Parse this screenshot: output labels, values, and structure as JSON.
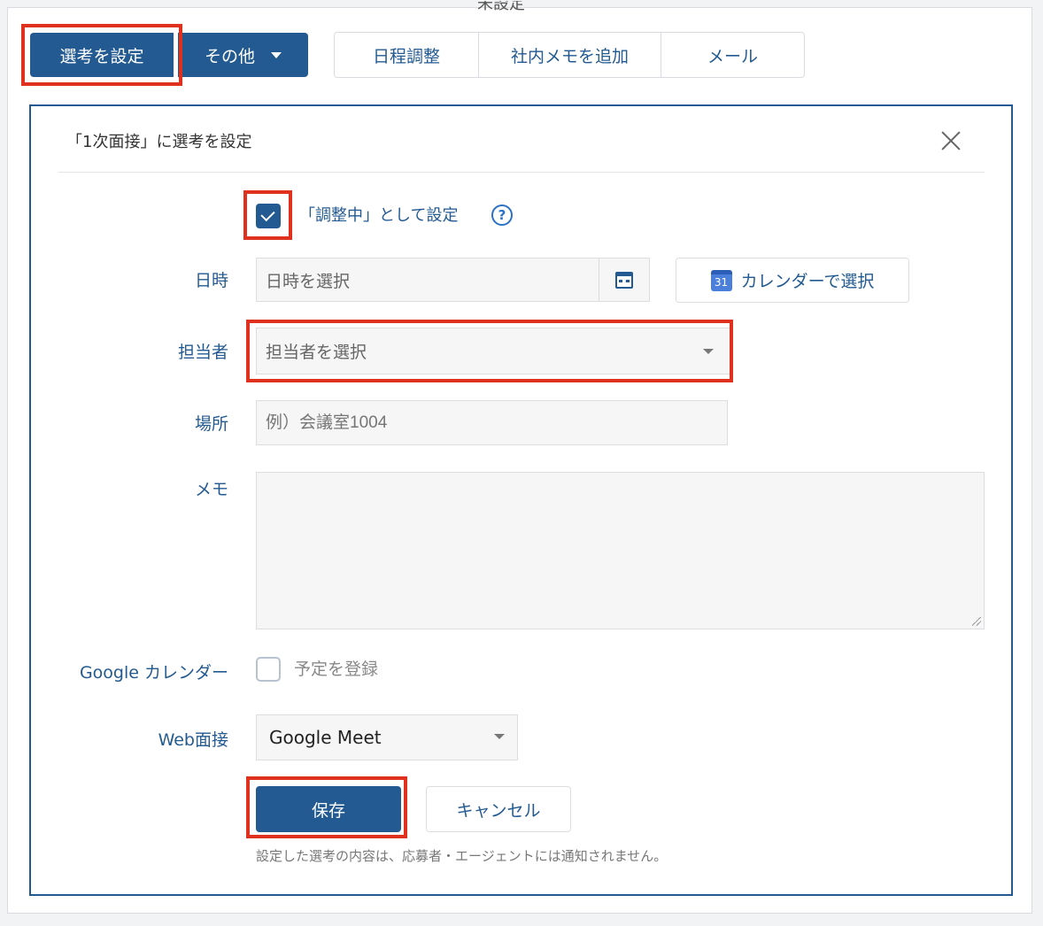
{
  "header": {
    "clipped_text": "未設定"
  },
  "toolbar": {
    "select_label": "選考を設定",
    "other_label": "その他",
    "segments": [
      "日程調整",
      "社内メモを追加",
      "メール"
    ]
  },
  "panel": {
    "title": "「1次面接」に選考を設定",
    "adjusting_label": "「調整中」として設定",
    "help_glyph": "?",
    "fields": {
      "datetime_label": "日時",
      "datetime_placeholder": "日時を選択",
      "calendar_button": "カレンダーで選択",
      "calendar_icon_text": "31",
      "assignee_label": "担当者",
      "assignee_placeholder": "担当者を選択",
      "place_label": "場所",
      "place_placeholder": "例）会議室1004",
      "memo_label": "メモ",
      "memo_value": "",
      "google_label": "Google カレンダー",
      "google_checkbox_label": "予定を登録",
      "web_label": "Web面接",
      "web_value": "Google Meet"
    },
    "save_label": "保存",
    "cancel_label": "キャンセル",
    "note": "設定した選考の内容は、応募者・エージェントには通知されません。"
  },
  "state": {
    "adjusting_checked": true,
    "register_checked": false
  },
  "colors": {
    "primary": "#235a91",
    "highlight": "#e0301e",
    "link": "#2b71c4"
  }
}
